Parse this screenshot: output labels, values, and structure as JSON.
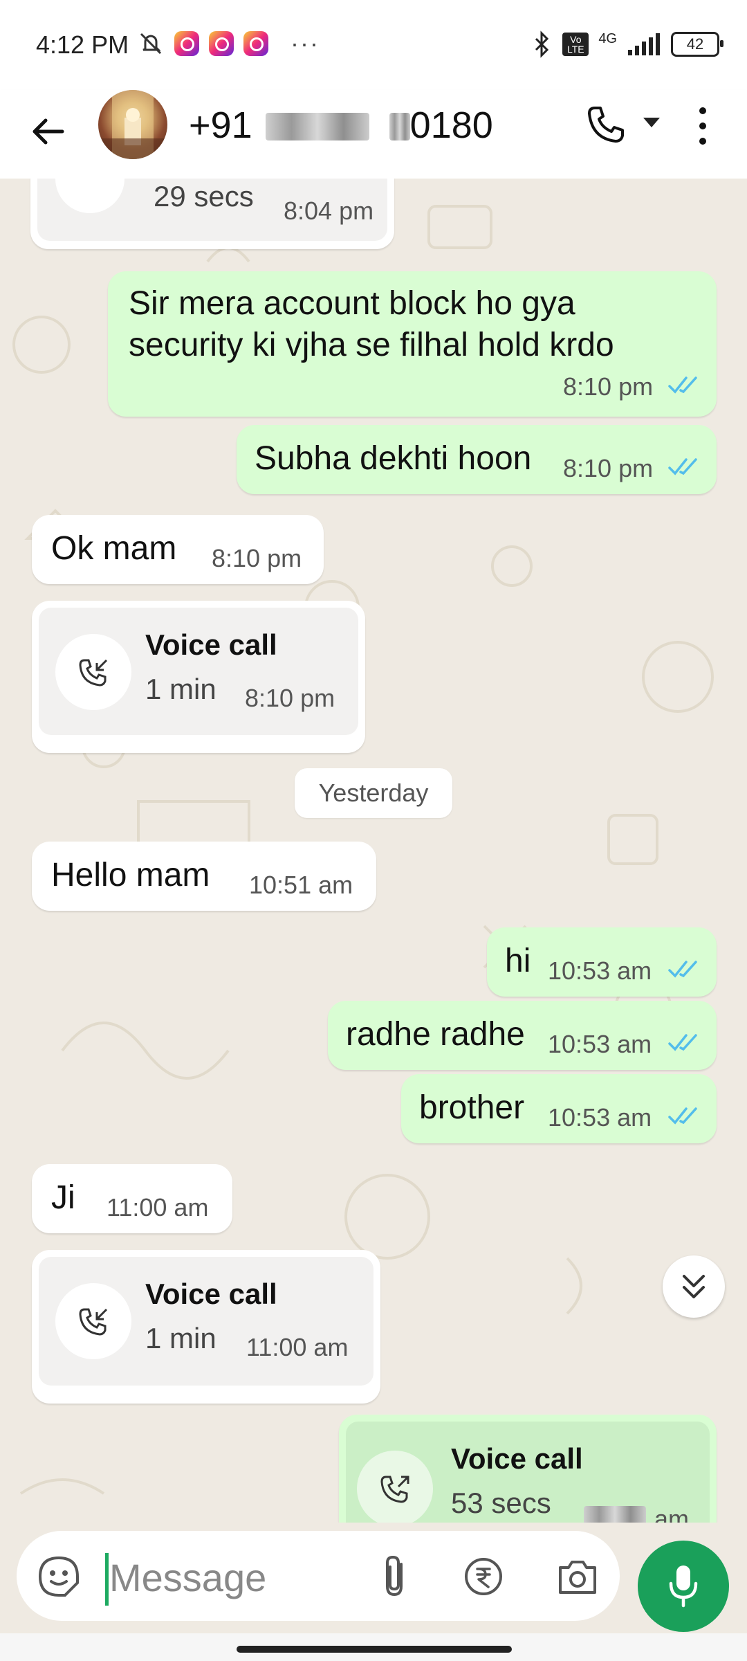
{
  "status_bar": {
    "time": "4:12 PM",
    "battery": "42",
    "network": "4G",
    "volte": "Vo LTE",
    "icons": [
      "mute-icon",
      "instagram-icon",
      "instagram-icon",
      "instagram-icon",
      "more-dots-icon",
      "bluetooth-icon",
      "volte-icon",
      "signal-icon",
      "battery-icon"
    ]
  },
  "header": {
    "contact_prefix": "+91",
    "contact_suffix": "0180",
    "icons": [
      "back-arrow-icon",
      "avatar",
      "phone-icon",
      "caret-down-icon",
      "kebab-menu-icon"
    ]
  },
  "messages": [
    {
      "type": "call",
      "dir": "in",
      "title": "",
      "duration": "29 secs",
      "time": "8:04 pm"
    },
    {
      "type": "text",
      "dir": "out",
      "lines": [
        "Sir mera account block ho gya",
        "security ki vjha se filhal hold krdo"
      ],
      "time": "8:10 pm",
      "read": true
    },
    {
      "type": "text",
      "dir": "out",
      "text": "Subha dekhti hoon",
      "time": "8:10 pm",
      "read": true
    },
    {
      "type": "text",
      "dir": "in",
      "text": "Ok mam",
      "time": "8:10 pm"
    },
    {
      "type": "call",
      "dir": "in",
      "title": "Voice call",
      "duration": "1 min",
      "time": "8:10 pm"
    },
    {
      "type": "date",
      "text": "Yesterday"
    },
    {
      "type": "text",
      "dir": "in",
      "text": "Hello mam",
      "time": "10:51 am"
    },
    {
      "type": "text",
      "dir": "out",
      "text": "hi",
      "time": "10:53 am",
      "read": true
    },
    {
      "type": "text",
      "dir": "out",
      "text": "radhe radhe",
      "time": "10:53 am",
      "read": true
    },
    {
      "type": "text",
      "dir": "out",
      "text": "brother",
      "time": "10:53 am",
      "read": true
    },
    {
      "type": "text",
      "dir": "in",
      "text": "Ji",
      "time": "11:00 am"
    },
    {
      "type": "call",
      "dir": "in",
      "title": "Voice call",
      "duration": "1 min",
      "time": "11:00 am"
    },
    {
      "type": "call",
      "dir": "out",
      "title": "Voice call",
      "duration": "53 secs",
      "time": "am"
    }
  ],
  "composer": {
    "placeholder": "Message",
    "icons": [
      "sticker-icon",
      "attach-icon",
      "rupee-icon",
      "camera-icon",
      "mic-icon"
    ]
  },
  "colors": {
    "outgoing_bubble": "#d9fdd3",
    "incoming_bubble": "#ffffff",
    "chat_background": "#efeae2",
    "read_ticks": "#53bdeb",
    "accent_green": "#1aa05a"
  }
}
